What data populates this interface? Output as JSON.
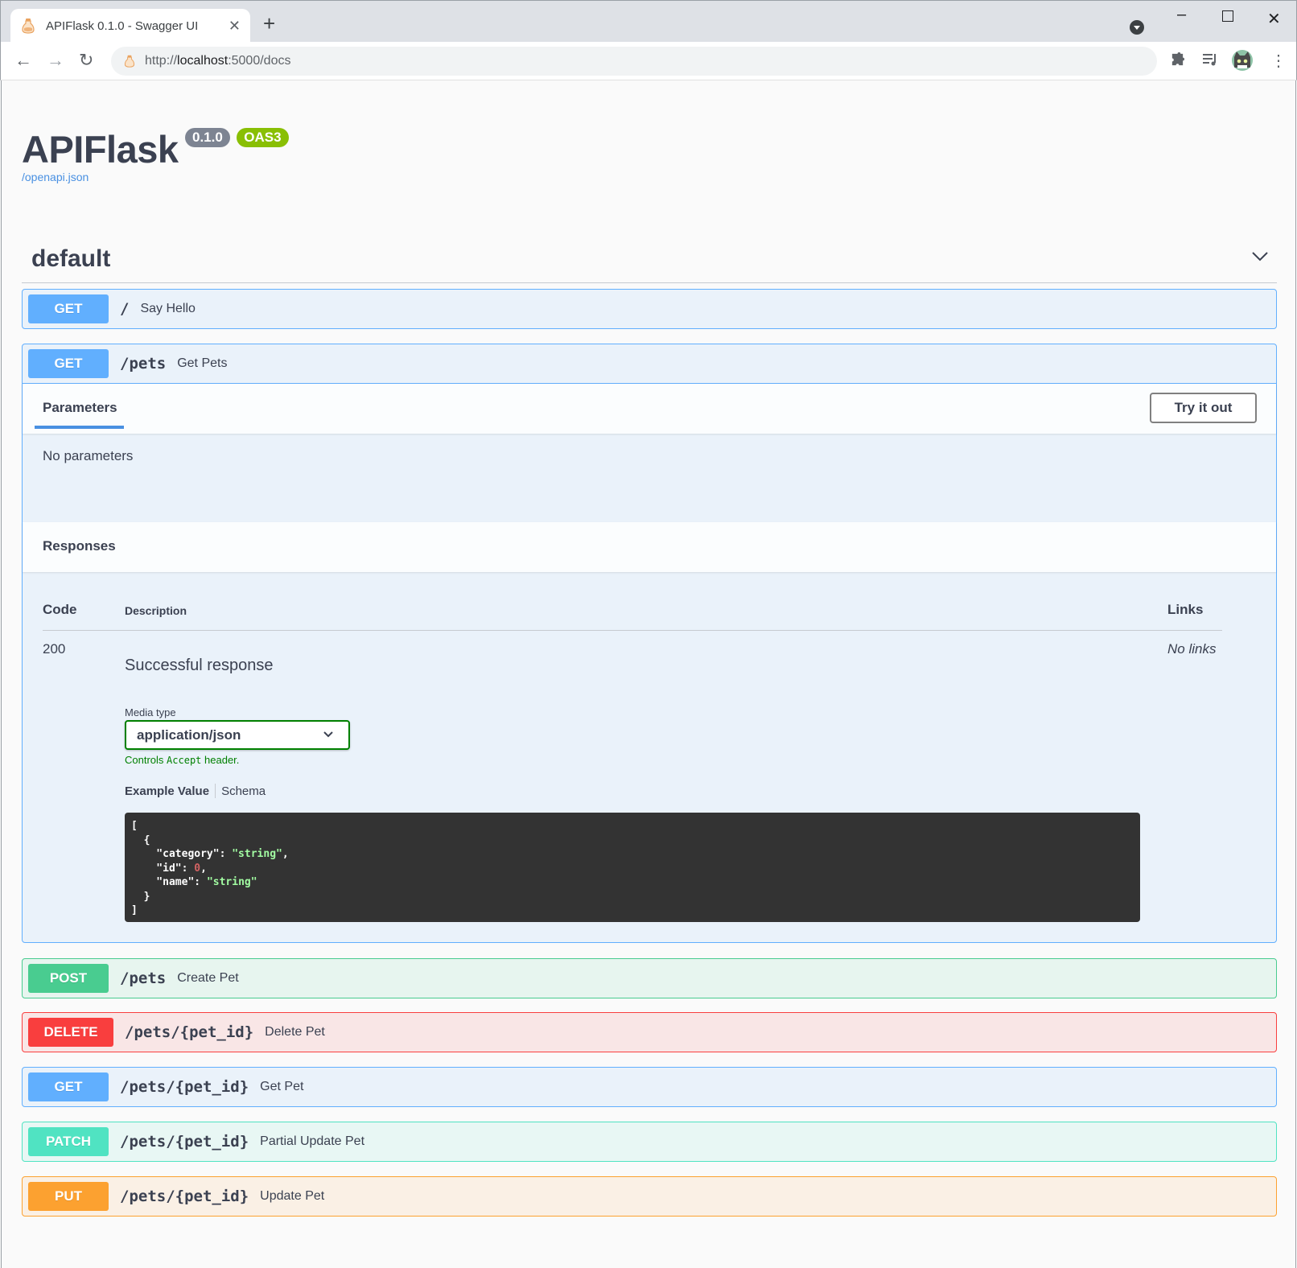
{
  "browser": {
    "tab_title": "APIFlask 0.1.0 - Swagger UI",
    "tab_close": "✕",
    "new_tab": "+",
    "url_prefix": "http://",
    "url_host": "localhost",
    "url_rest": ":5000/docs"
  },
  "info": {
    "title": "APIFlask",
    "version": "0.1.0",
    "oas_badge": "OAS3",
    "spec_link": "/openapi.json"
  },
  "tag": {
    "name": "default"
  },
  "operations": [
    {
      "method": "GET",
      "path": "/",
      "summary": "Say Hello"
    },
    {
      "method": "GET",
      "path": "/pets",
      "summary": "Get Pets"
    },
    {
      "method": "POST",
      "path": "/pets",
      "summary": "Create Pet"
    },
    {
      "method": "DELETE",
      "path": "/pets/{pet_id}",
      "summary": "Delete Pet"
    },
    {
      "method": "GET",
      "path": "/pets/{pet_id}",
      "summary": "Get Pet"
    },
    {
      "method": "PATCH",
      "path": "/pets/{pet_id}",
      "summary": "Partial Update Pet"
    },
    {
      "method": "PUT",
      "path": "/pets/{pet_id}",
      "summary": "Update Pet"
    }
  ],
  "expanded": {
    "parameters_tab": "Parameters",
    "try_button": "Try it out",
    "no_parameters": "No parameters",
    "responses_title": "Responses",
    "columns": {
      "code": "Code",
      "description": "Description",
      "links": "Links"
    },
    "response": {
      "code": "200",
      "description": "Successful response",
      "links": "No links"
    },
    "media_type_label": "Media type",
    "media_type_value": "application/json",
    "controls_prefix": "Controls",
    "controls_code": "Accept",
    "controls_suffix": "header.",
    "example_tab": "Example Value",
    "schema_tab": "Schema",
    "example": {
      "open_bracket": "[",
      "open_brace": "  {",
      "key_category": "    \"category\"",
      "val_category": "\"string\"",
      "key_id": "    \"id\"",
      "val_id": "0",
      "key_name": "    \"name\"",
      "val_name": "\"string\"",
      "close_brace": "  }",
      "close_bracket": "]"
    }
  },
  "colors": {
    "get": "#61affe",
    "post": "#49cc90",
    "delete": "#f93e3e",
    "patch": "#50e3c2",
    "put": "#fca130"
  }
}
